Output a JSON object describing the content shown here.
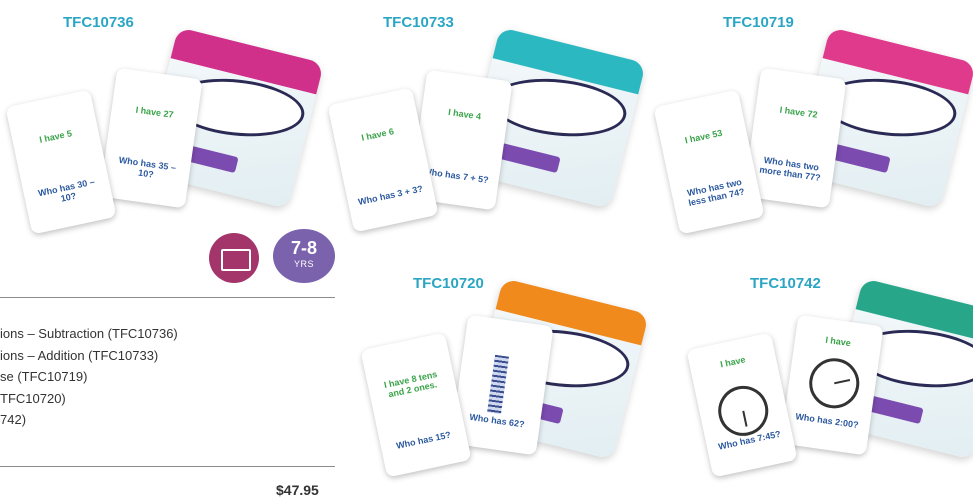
{
  "products": [
    {
      "code": "TFC10736",
      "band_color": "#d0308a",
      "left_card": {
        "top": "I have 5",
        "bottom": "Who has 30 – 10?"
      },
      "right_card": {
        "top": "I have 27",
        "bottom": "Who has 35 – 10?"
      }
    },
    {
      "code": "TFC10733",
      "band_color": "#2bb8c0",
      "left_card": {
        "top": "I have 6",
        "bottom": "Who has 3 + 3?"
      },
      "right_card": {
        "top": "I have 4",
        "bottom": "Who has 7 + 5?"
      }
    },
    {
      "code": "TFC10719",
      "band_color": "#e03a8c",
      "left_card": {
        "top": "I have 53",
        "bottom": "Who has two less than 74?"
      },
      "right_card": {
        "top": "I have 72",
        "bottom": "Who has two more than 77?"
      }
    },
    {
      "code": "TFC10720",
      "band_color": "#f08a1c",
      "left_card": {
        "top": "I have 8 tens and 2 ones.",
        "bottom": "Who has 15?"
      },
      "right_card": {
        "top": "",
        "bottom": "Who has 62?"
      }
    },
    {
      "code": "TFC10742",
      "band_color": "#27a68a",
      "left_card": {
        "top": "I have",
        "bottom": "Who has 7:45?"
      },
      "right_card": {
        "top": "I have",
        "bottom": "Who has 2:00?"
      }
    }
  ],
  "age_badge": {
    "range": "7-8",
    "unit": "YRS",
    "color": "#7a62ad"
  },
  "card_icon_color": "#a3356a",
  "set_list": [
    "ions – Subtraction (TFC10736)",
    "ions – Addition (TFC10733)",
    "se (TFC10719)",
    "TFC10720)",
    "742)"
  ],
  "price": "$47.95"
}
